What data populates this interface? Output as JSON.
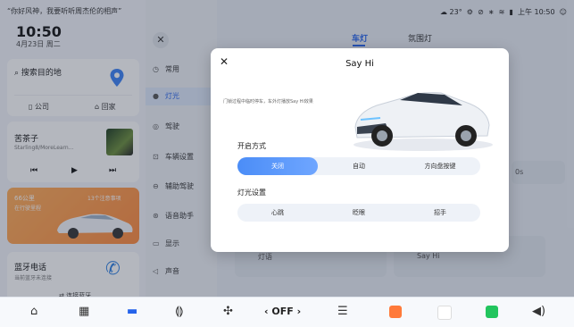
{
  "left": {
    "voice_prompt": "“你好风神，我要听听周杰伦的相声”",
    "time": "10:50",
    "date": "4月23日 周二",
    "nav": {
      "search_label": "搜索目的地",
      "company_label": "公司",
      "home_label": "回家"
    },
    "music": {
      "song": "苦茶子",
      "artist": "Starling8/MoreLearn...",
      "prev_icon": "prev-icon",
      "play_icon": "play-icon",
      "next_icon": "next-icon"
    },
    "promo": {
      "line1": "66公里",
      "line2": "在行驶里程",
      "line3": "13个注意事项"
    },
    "phone": {
      "title": "蓝牙电话",
      "subtitle": "当前蓝牙未连接",
      "connect_label": "连接蓝牙"
    }
  },
  "menu": {
    "items": [
      {
        "label": "常用",
        "icon": "clock-icon"
      },
      {
        "label": "灯光",
        "icon": "bulb-icon"
      },
      {
        "label": "驾驶",
        "icon": "steering-icon"
      },
      {
        "label": "车辆设置",
        "icon": "car-icon"
      },
      {
        "label": "辅助驾驶",
        "icon": "assist-icon"
      },
      {
        "label": "语音助手",
        "icon": "voice-icon"
      },
      {
        "label": "显示",
        "icon": "display-icon"
      },
      {
        "label": "声音",
        "icon": "sound-icon"
      }
    ],
    "active_index": 1
  },
  "top": {
    "tabs": [
      "车灯",
      "氛围灯"
    ],
    "status_temp": "23°",
    "status_time": "上午 10:50"
  },
  "background": {
    "label_a": "灯语",
    "label_b": "Say Hi",
    "value_s": "0s"
  },
  "modal": {
    "title": "Say Hi",
    "description": "门锁过程中临时停车，车外灯播放Say Hi效果",
    "section_open": "开启方式",
    "open_options": [
      "关闭",
      "自动",
      "方向盘按键"
    ],
    "section_light": "灯光设置",
    "light_options": [
      "心跳",
      "眨眼",
      "招手"
    ]
  },
  "dock": {
    "ac_label": "OFF",
    "colors": {
      "accent": "#2563eb",
      "orange": "#ff8a3d"
    }
  }
}
